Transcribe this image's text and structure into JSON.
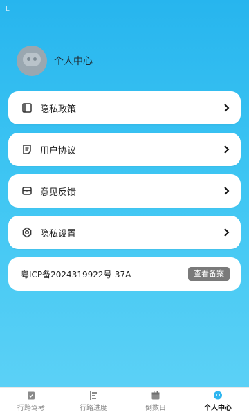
{
  "status": {
    "mark": "L"
  },
  "profile": {
    "name": "个人中心"
  },
  "menu": [
    {
      "label": "隐私政策",
      "icon": "book-icon"
    },
    {
      "label": "用户协议",
      "icon": "document-icon"
    },
    {
      "label": "意见反馈",
      "icon": "feedback-box-icon"
    },
    {
      "label": "隐私设置",
      "icon": "gear-icon"
    }
  ],
  "icp": {
    "text": "粤ICP备2024319922号-37A",
    "button": "查看备案"
  },
  "tabs": [
    {
      "label": "行路驾考",
      "icon": "clipboard-check-icon",
      "active": false
    },
    {
      "label": "行路进度",
      "icon": "progress-bars-icon",
      "active": false
    },
    {
      "label": "倒数日",
      "icon": "calendar-icon",
      "active": false
    },
    {
      "label": "个人中心",
      "icon": "profile-bubble-icon",
      "active": true
    }
  ],
  "colors": {
    "accent": "#27b5ee",
    "active_tab_icon": "#2fb6f0",
    "inactive": "#8a8a8a"
  }
}
